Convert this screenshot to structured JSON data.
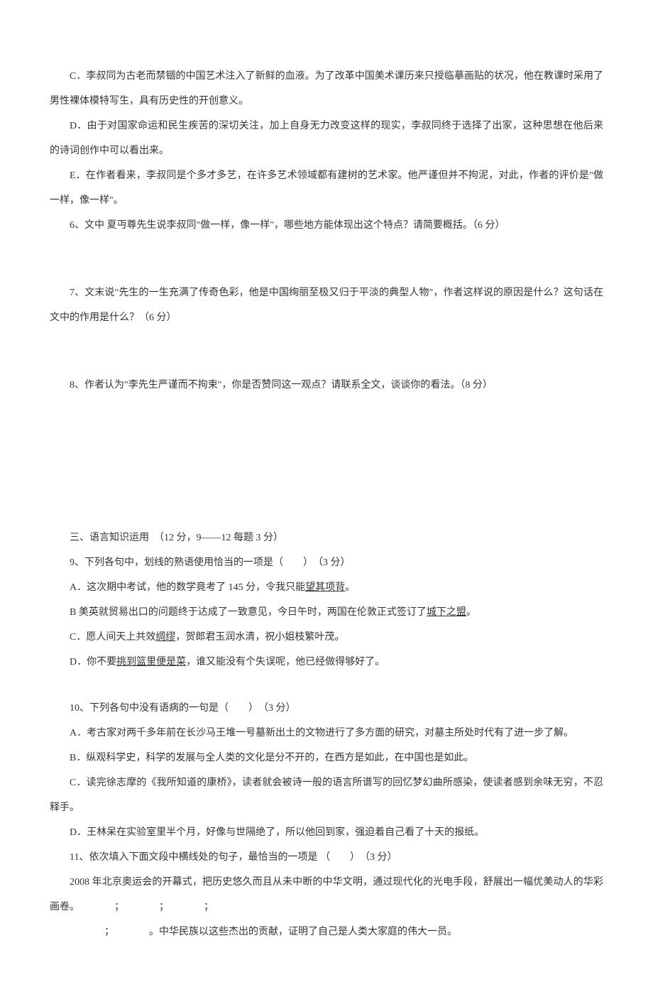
{
  "optC": "C．李叔同为古老而禁锢的中国艺术注入了新鲜的血液。为了改革中国美术课历来只授临摹画贴的状况，他在教课时采用了男性裸体模特写生，具有历史性的开创意义。",
  "optD": "D．由于对国家命运和民生疾苦的深切关注，加上自身无力改变这样的现实，李叔同终于选择了出家，这种思想在他后来的诗词创作中可以看出来。",
  "optE": "E．在作者看来，李叔同是个多才多艺，在许多艺术领域都有建树的艺术家。他严谨但并不拘泥，对此，作者的评价是\"做一样，像一样\"。",
  "q6": "6、文中 夏丏尊先生说李叔同\"做一样，像一样\"，哪些地方能体现出这个特点？请简要概括。（6 分）",
  "q7": "7、文末说\"先生的一生充满了传奇色彩，他是中国绚丽至极又归于平淡的典型人物\"，作者这样说的原因是什么？这句话在文中的作用是什么？（6 分）",
  "q8": "8、作者认为\"李先生严谨而不拘束\"，你是否赞同这一观点？请联系全文，谈谈你的看法。（8 分）",
  "sec3": "三、语言知识运用　（12 分，9——12 每题 3 分）",
  "q9": {
    "stem": "9、下列各句中，划线的熟语使用恰当的一项是（　　）　（3 分）",
    "A_pre": "A．这次期中考试，他的数学竟考了 145 分，令我只能",
    "A_ul": "望其项背",
    "A_post": "。",
    "B_pre": "B 美英就贸易出口的问题终于达成了一致意见，今日午时，两国在伦敦正式签订了",
    "B_ul": "城下之盟",
    "B_post": "。",
    "C_pre": "C．愿人间天上共效",
    "C_ul": "绸缪",
    "C_post": "，贺郎君玉润水清，祝小姐枝繁叶茂。",
    "D_pre": "D．你不要",
    "D_ul": "挑到篮里便是菜",
    "D_post": "，谁又能没有个失误呢，他已经做得够好了。"
  },
  "q10": {
    "stem": "10、下列各句中没有语病的一句是（　　）　（3 分）",
    "A": "A．考古家对两千多年前在长沙马王堆一号墓新出土的文物进行了多方面的研究，对墓主所处时代有了进一步了解。",
    "B": "B．纵观科学史，科学的发展与全人类的文化是分不开的，在西方是如此，在中国也是如此。",
    "C": "C．读完徐志摩的《我所知道的康桥》，读者就会被诗一般的语言所谱写的回忆梦幻曲所感染，使读者感到余味无穷，不忍释手。",
    "D": "D．王林呆在实验室里半个月，好像与世隔绝了，所以他回到家，强迫着自己看了十天的报纸。"
  },
  "q11": {
    "stem": "11、依次填入下面文段中横线处的句子，最恰当的一项是 （　　）　（3 分）",
    "body_pre": "2008 年北京奥运会的开幕式，把历史悠久而且从未中断的中华文明，通过现代化的光电手段，舒展出一幅优美动人的华彩画卷。",
    "body_post": "。中华民族以这些杰出的贡献，证明了自己是人类大家庭的伟大一员。",
    "sep": "；"
  }
}
